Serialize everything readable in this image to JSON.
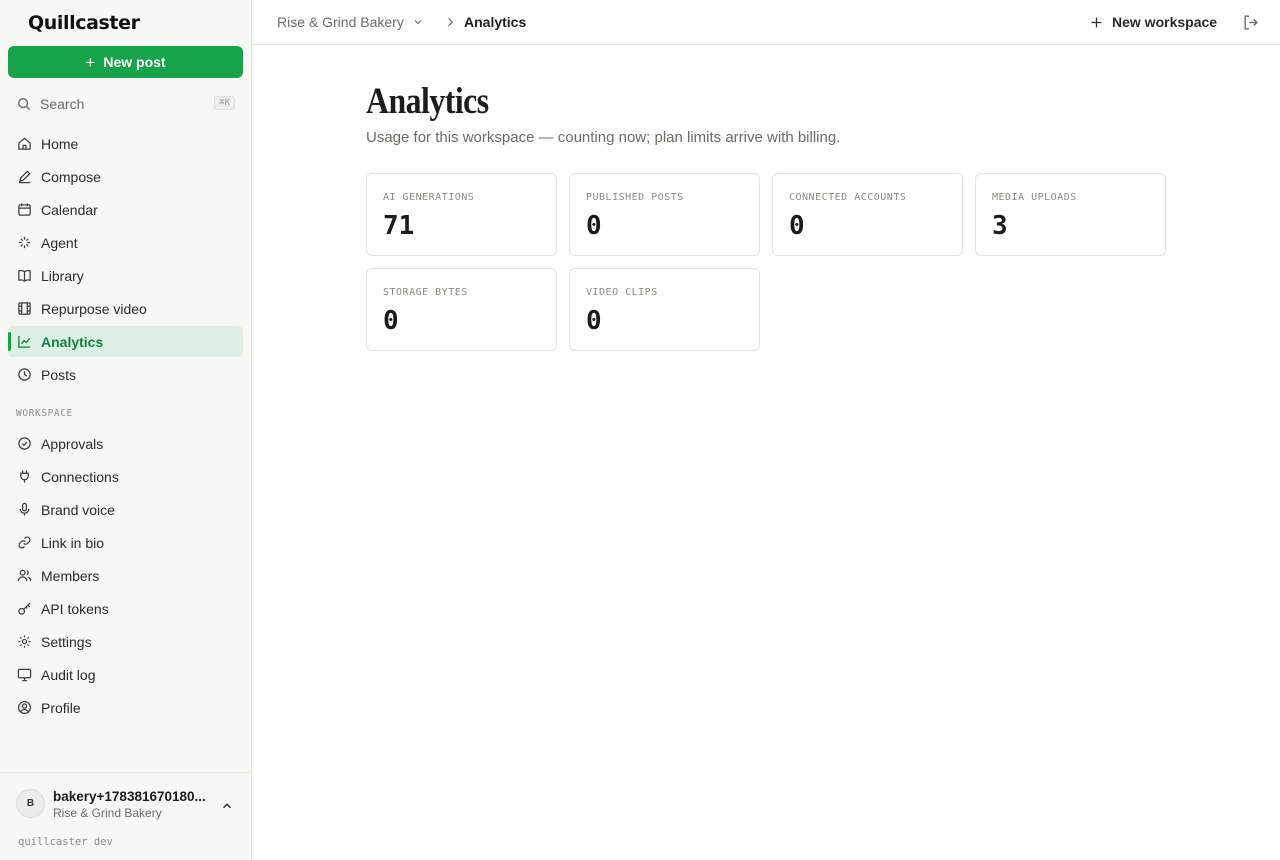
{
  "brand": {
    "name": "Quillcaster",
    "accent": "#16a34a"
  },
  "sidebar": {
    "new_post_label": "New post",
    "search_label": "Search",
    "search_shortcut": "⌘K",
    "main_items": [
      {
        "label": "Home",
        "icon": "home-icon"
      },
      {
        "label": "Compose",
        "icon": "pencil-icon"
      },
      {
        "label": "Calendar",
        "icon": "calendar-icon"
      },
      {
        "label": "Agent",
        "icon": "sparkle-icon"
      },
      {
        "label": "Library",
        "icon": "book-icon"
      },
      {
        "label": "Repurpose video",
        "icon": "film-icon"
      },
      {
        "label": "Analytics",
        "icon": "chart-icon",
        "active": true
      },
      {
        "label": "Posts",
        "icon": "clock-icon"
      }
    ],
    "section_label": "WORKSPACE",
    "workspace_items": [
      {
        "label": "Approvals",
        "icon": "check-circle-icon"
      },
      {
        "label": "Connections",
        "icon": "plug-icon"
      },
      {
        "label": "Brand voice",
        "icon": "mic-icon"
      },
      {
        "label": "Link in bio",
        "icon": "link-icon"
      },
      {
        "label": "Members",
        "icon": "users-icon"
      },
      {
        "label": "API tokens",
        "icon": "key-icon"
      },
      {
        "label": "Settings",
        "icon": "gear-icon"
      },
      {
        "label": "Audit log",
        "icon": "monitor-icon"
      },
      {
        "label": "Profile",
        "icon": "user-circle-icon"
      }
    ],
    "user": {
      "initial": "B",
      "name": "bakery+178381670180...",
      "workspace": "Rise & Grind Bakery"
    },
    "env_label": "quillcaster dev"
  },
  "topbar": {
    "workspace": "Rise & Grind Bakery",
    "current": "Analytics",
    "new_workspace_label": "New workspace"
  },
  "main": {
    "title": "Analytics",
    "subtitle": "Usage for this workspace — counting now; plan limits arrive with billing.",
    "stats": [
      {
        "label": "AI GENERATIONS",
        "value": "71"
      },
      {
        "label": "PUBLISHED POSTS",
        "value": "0"
      },
      {
        "label": "CONNECTED ACCOUNTS",
        "value": "0"
      },
      {
        "label": "MEDIA UPLOADS",
        "value": "3"
      },
      {
        "label": "STORAGE BYTES",
        "value": "0"
      },
      {
        "label": "VIDEO CLIPS",
        "value": "0"
      }
    ]
  }
}
